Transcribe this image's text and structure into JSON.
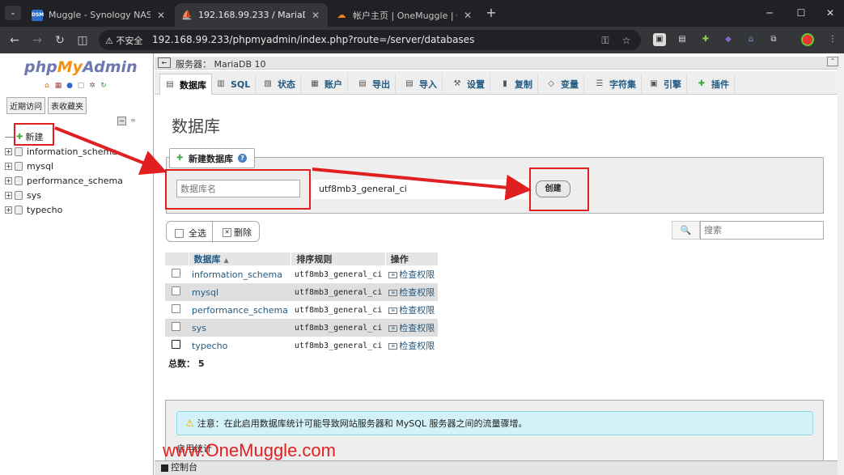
{
  "browser": {
    "tabs": [
      {
        "title": "Muggle - Synology NAS",
        "favicon_text": "DSM",
        "favicon_color": "#2d6ecb",
        "active": false
      },
      {
        "title": "192.168.99.233 / MariaDB 10",
        "favicon_text": "",
        "favicon_color": "#f29111",
        "active": true
      },
      {
        "title": "帐户主页 | OneMuggle | Clou",
        "favicon_text": "",
        "favicon_color": "#f48120",
        "active": false
      }
    ],
    "new_tab": "+",
    "address": {
      "security_label": "不安全",
      "url": "192.168.99.233/phpmyadmin/index.php?route=/server/databases"
    }
  },
  "nav": {
    "logo": {
      "php": "php",
      "my": "My",
      "admin": "Admin"
    },
    "recent_btn": "近期访问",
    "favorites_btn": "表收藏夹",
    "tree": [
      {
        "label": "新建",
        "type": "new"
      },
      {
        "label": "information_schema",
        "type": "db"
      },
      {
        "label": "mysql",
        "type": "db"
      },
      {
        "label": "performance_schema",
        "type": "db"
      },
      {
        "label": "sys",
        "type": "db"
      },
      {
        "label": "typecho",
        "type": "db"
      }
    ]
  },
  "main": {
    "server_label": "服务器： MariaDB 10",
    "tabs": [
      {
        "label": "数据库",
        "icon": "database-icon"
      },
      {
        "label": "SQL",
        "icon": "sql-icon"
      },
      {
        "label": "状态",
        "icon": "status-icon"
      },
      {
        "label": "账户",
        "icon": "accounts-icon"
      },
      {
        "label": "导出",
        "icon": "export-icon"
      },
      {
        "label": "导入",
        "icon": "import-icon"
      },
      {
        "label": "设置",
        "icon": "settings-icon"
      },
      {
        "label": "复制",
        "icon": "replication-icon"
      },
      {
        "label": "变量",
        "icon": "variables-icon"
      },
      {
        "label": "字符集",
        "icon": "charset-icon"
      },
      {
        "label": "引擎",
        "icon": "engine-icon"
      },
      {
        "label": "插件",
        "icon": "plugins-icon"
      }
    ],
    "page_title": "数据库",
    "create": {
      "legend": "新建数据库",
      "name_placeholder": "数据库名",
      "collation": "utf8mb3_general_ci",
      "button": "创建"
    },
    "filter": {
      "select_all": "全选",
      "delete": "删除",
      "search_placeholder": "搜索"
    },
    "table": {
      "headers": [
        "数据库",
        "排序规则",
        "操作"
      ],
      "rows": [
        {
          "name": "information_schema",
          "collation": "utf8mb3_general_ci",
          "action": "检查权限"
        },
        {
          "name": "mysql",
          "collation": "utf8mb3_general_ci",
          "action": "检查权限"
        },
        {
          "name": "performance_schema",
          "collation": "utf8mb3_general_ci",
          "action": "检查权限"
        },
        {
          "name": "sys",
          "collation": "utf8mb3_general_ci",
          "action": "检查权限"
        },
        {
          "name": "typecho",
          "collation": "utf8mb3_general_ci",
          "action": "检查权限"
        }
      ],
      "total_label": "总数：",
      "total_count": "5"
    },
    "notice": "注意：在此启用数据库统计可能导致网站服务器和 MySQL 服务器之间的流量骤增。",
    "enable_stats": "启用统计",
    "console": "控制台",
    "watermark": "www.OneMuggle.com"
  },
  "colors": {
    "highlight": "#e02020",
    "link": "#235a81"
  }
}
